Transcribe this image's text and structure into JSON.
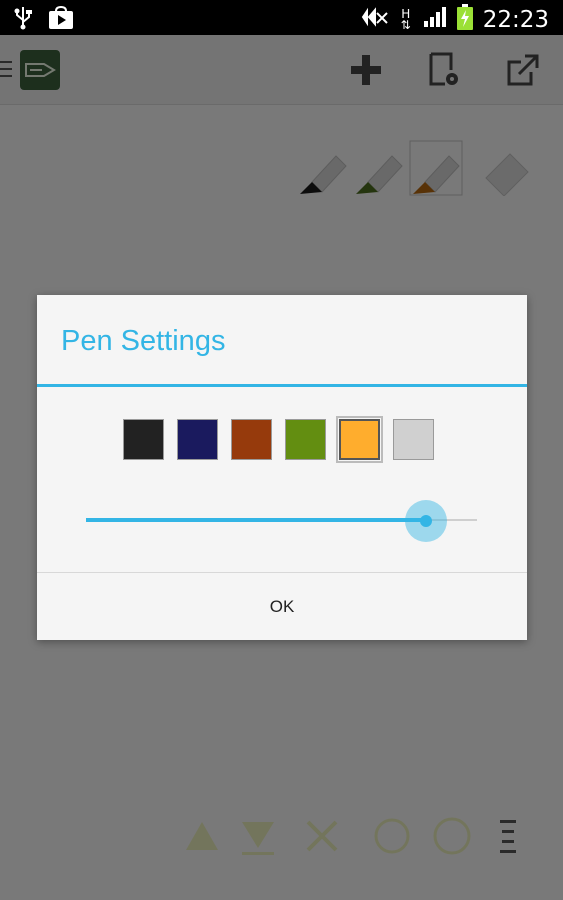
{
  "status_bar": {
    "time": "22:23",
    "network_type": "H",
    "icons": [
      "usb-icon",
      "play-store-icon",
      "signal-muted-icon",
      "cell-signal-icon",
      "battery-charging-icon"
    ]
  },
  "action_bar": {
    "icons": [
      "menu-icon",
      "app-logo-icon",
      "add-icon",
      "page-settings-icon",
      "share-icon"
    ]
  },
  "canvas": {
    "pen_tools": [
      {
        "name": "pen-black-icon",
        "color": "#1a1a1a"
      },
      {
        "name": "pen-green-icon",
        "color": "#4b6b1f"
      },
      {
        "name": "pen-orange-icon",
        "color": "#b0650f"
      },
      {
        "name": "eraser-icon",
        "color": "#9a9a9a"
      }
    ],
    "bottom_tools": [
      "undo-icon",
      "redo-icon",
      "clear-icon",
      "zoom-out-icon",
      "zoom-in-icon",
      "more-menu-icon"
    ]
  },
  "dialog": {
    "title": "Pen Settings",
    "ok_label": "OK",
    "colors": [
      "#222222",
      "#1a1a5e",
      "#963a0c",
      "#638e11",
      "#ffad2d",
      "#d0d0d0"
    ],
    "selected_color_index": 4,
    "pen_width_fraction": 0.87,
    "accent": "#33b5e5"
  }
}
